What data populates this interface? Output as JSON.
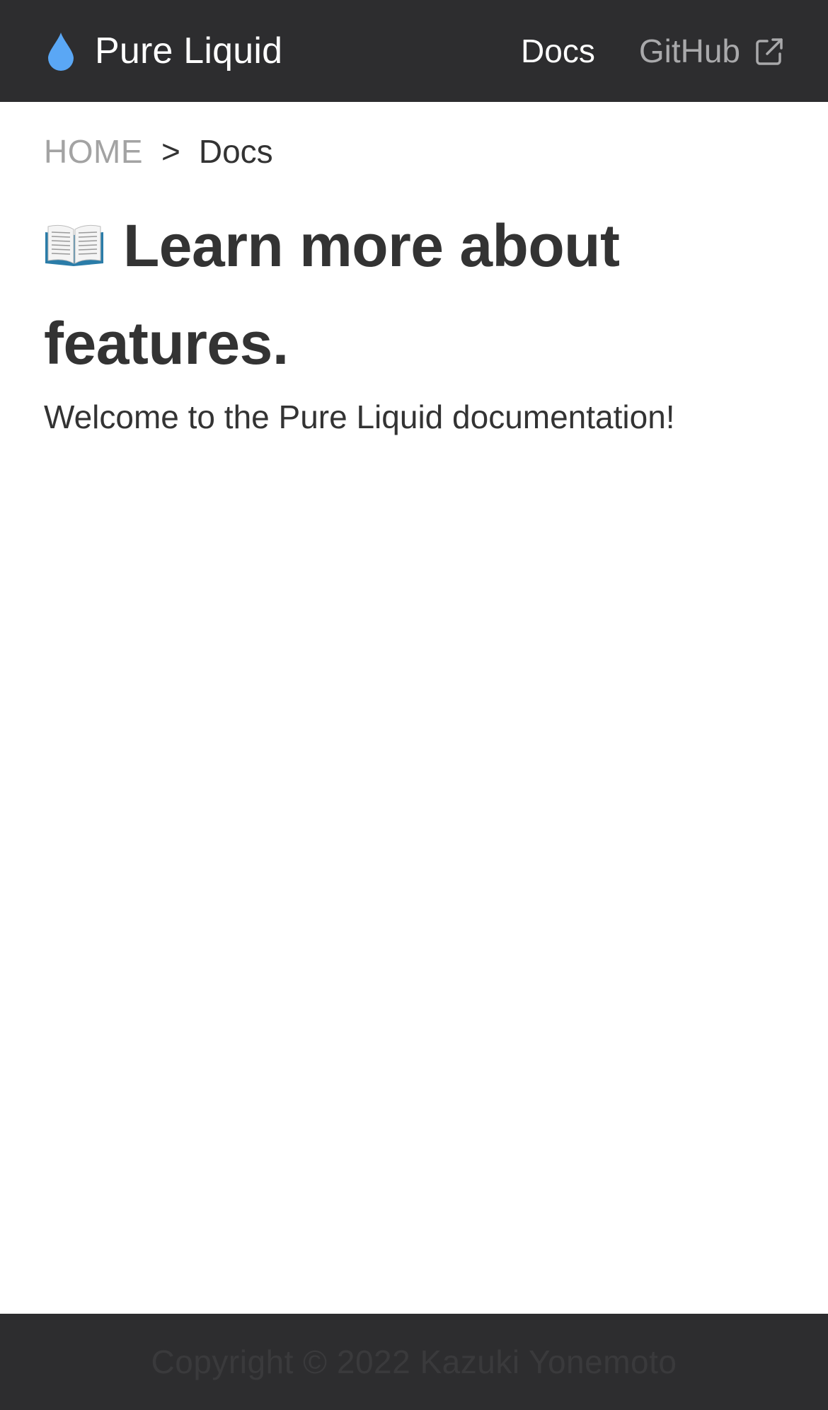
{
  "navbar": {
    "brand_icon": "water-drop-icon",
    "brand_name": "Pure Liquid",
    "links": {
      "docs": "Docs",
      "github": "GitHub",
      "github_icon": "external-link-icon"
    }
  },
  "breadcrumb": {
    "home": "HOME",
    "separator": ">",
    "current": "Docs"
  },
  "main": {
    "title_icon": "open-book-icon",
    "title": "Learn more about features.",
    "intro": "Welcome to the Pure Liquid documentation!"
  },
  "footer": {
    "copyright": "Copyright © 2022 Kazuki Yonemoto"
  },
  "colors": {
    "navbar_bg": "#2d2d2f",
    "accent_drop": "#5aa7f5",
    "text": "#333333",
    "muted": "#a3a3a3"
  }
}
